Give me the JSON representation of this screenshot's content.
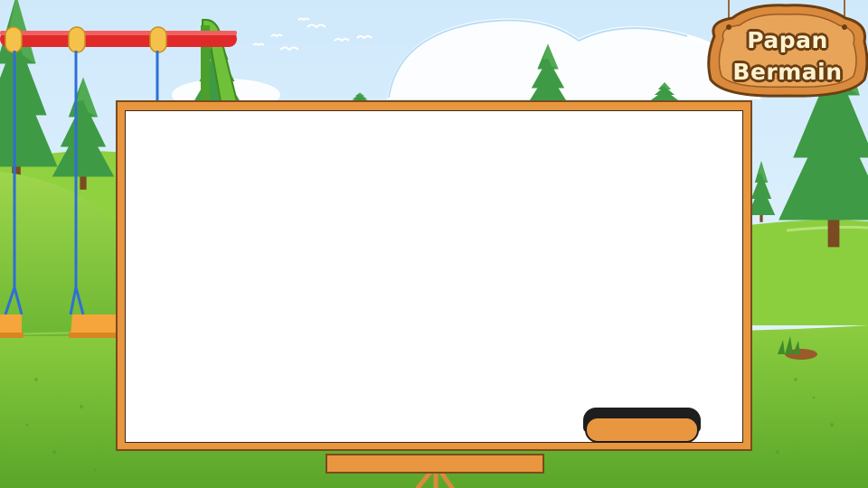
{
  "sign": {
    "line1": "Papan",
    "line2": "Bermain"
  },
  "colors": {
    "sky": "#d4ecfa",
    "grass": "#7cc23a",
    "board_frame": "#e8963f",
    "board_surface": "#ffffff",
    "swing_bar": "#e02a2a",
    "slide": "#6fc13a",
    "sign_wood": "#d98a3d"
  },
  "icons": [
    "pine-tree-icon",
    "swing-icon",
    "slide-icon",
    "bird-icon",
    "cloud-icon",
    "grass-tuft-icon"
  ]
}
